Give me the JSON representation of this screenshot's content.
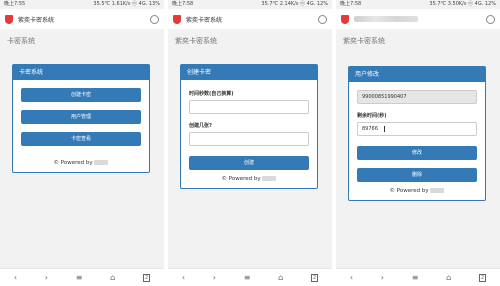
{
  "screens": [
    {
      "status": {
        "time": "晚上7:55",
        "right": "35.5℃ 1.61K/s ⓝ 4G. 13%"
      },
      "app_title": "紫奕卡密系统",
      "brand": "卡密系统",
      "panel_title": "卡密系统",
      "buttons": [
        "创建卡密",
        "用户管理",
        "卡密查看"
      ],
      "powered": "© Powered by"
    },
    {
      "status": {
        "time": "晚上7:58",
        "right": "35.7℃ 2.14K/s ⓝ 4G. 12%"
      },
      "app_title": "紫奕卡密系统",
      "brand": "紫奕卡密系统",
      "panel_title": "创建卡密",
      "fields": [
        {
          "label": "时间秒数(自己换算)",
          "value": ""
        },
        {
          "label": "创建几张?",
          "value": ""
        }
      ],
      "submit": "创建",
      "powered": "© Powered by"
    },
    {
      "status": {
        "time": "晚上7:58",
        "right": "35.7℃ 3.50K/s ⓝ 4G. 12%"
      },
      "brand": "紫奕卡密系统",
      "panel_title": "用户修改",
      "user_id": "99000851990407",
      "field_label": "剩余时间(秒)",
      "field_value": "89766",
      "buttons": [
        "修改",
        "删除"
      ],
      "powered": "© Powered by"
    }
  ],
  "nav": [
    "‹",
    "›",
    "≡",
    "⌂",
    "2"
  ],
  "colors": {
    "accent": "#337ab7",
    "brand_icon": "#e53935"
  }
}
